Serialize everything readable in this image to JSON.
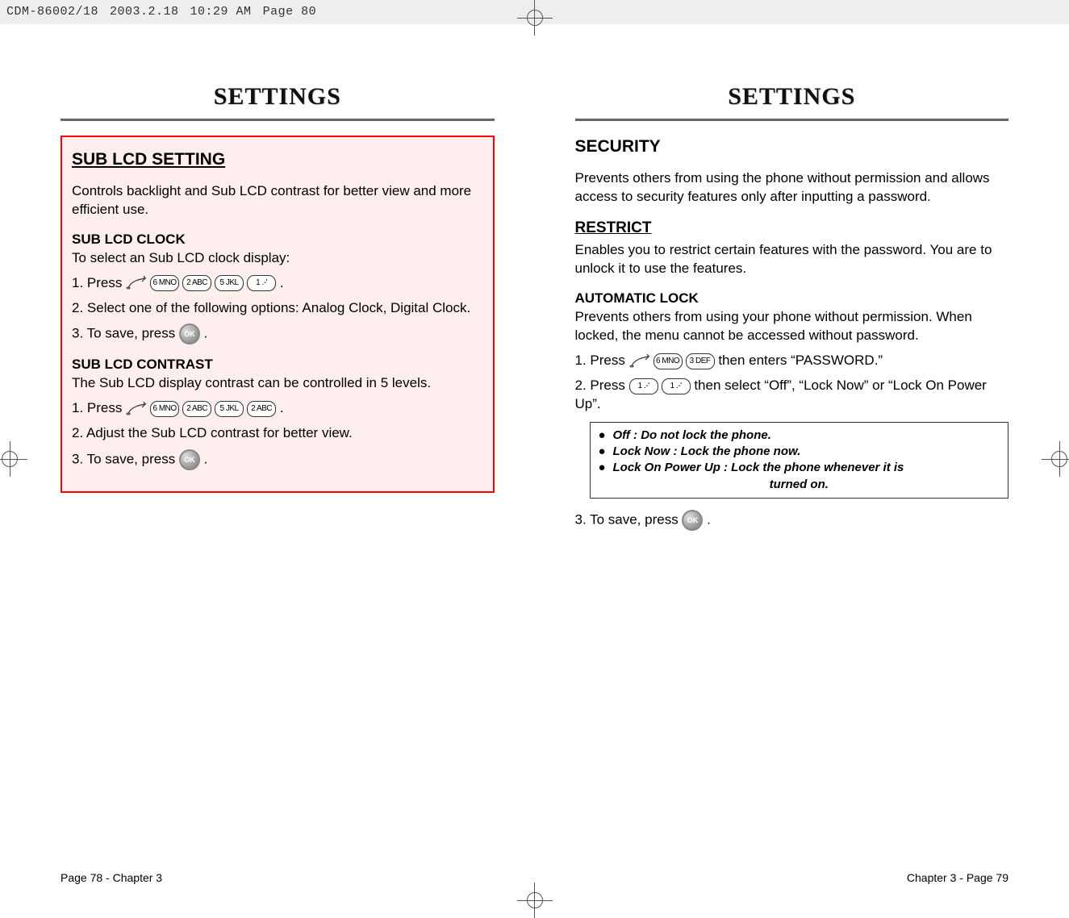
{
  "print_meta": {
    "file": "CDM-86002/18",
    "date": "2003.2.18",
    "time": "10:29 AM",
    "page_label": "Page 80"
  },
  "headings": {
    "settings": "SETTINGS"
  },
  "left": {
    "title": "SUB LCD SETTING",
    "intro": "Controls backlight and Sub LCD contrast for better view and more efficient use.",
    "clock": {
      "heading": "SUB LCD CLOCK",
      "desc": "To select an Sub LCD clock display:",
      "step1_prefix": "1. Press",
      "step1_suffix": ".",
      "key_seq": [
        "6 MNO",
        "2 ABC",
        "5 JKL",
        "1 .-'"
      ],
      "step2": "2. Select one of the following options:  Analog Clock, Digital Clock.",
      "step3_prefix": "3. To save, press",
      "step3_suffix": "."
    },
    "contrast": {
      "heading": "SUB LCD CONTRAST",
      "desc": "The Sub LCD display contrast can be controlled in 5 levels.",
      "step1_prefix": "1. Press",
      "step1_suffix": ".",
      "key_seq": [
        "6 MNO",
        "2 ABC",
        "5 JKL",
        "2 ABC"
      ],
      "step2": "2. Adjust the Sub LCD contrast for better view.",
      "step3_prefix": "3. To save, press",
      "step3_suffix": "."
    },
    "footer": "Page 78 - Chapter 3"
  },
  "right": {
    "title": "SECURITY",
    "intro": "Prevents others from using the phone without permission and allows access to security features only after inputting a password.",
    "restrict": {
      "heading": "RESTRICT",
      "desc": "Enables you to restrict certain features with the password. You are to unlock it to use the features."
    },
    "autolock": {
      "heading": "AUTOMATIC LOCK",
      "desc": "Prevents others from using your phone without permission. When locked, the menu cannot be accessed without password.",
      "step1_prefix": "1. Press",
      "step1_mid": "then enters",
      "step1_password": "“PASSWORD.”",
      "key_seq1": [
        "6 MNO",
        "3 DEF"
      ],
      "step2_prefix": "2. Press",
      "step2_mid": "then select",
      "step2_options": "“Off”, “Lock Now” or “Lock On Power Up”.",
      "key_seq2": [
        "1 .-'",
        "1 .-'"
      ],
      "options": [
        "Off : Do not lock the phone.",
        "Lock Now : Lock the phone now.",
        "Lock On Power Up : Lock the phone whenever it is"
      ],
      "options_cont": "turned on.",
      "step3_prefix": "3. To save, press",
      "step3_suffix": "."
    },
    "footer": "Chapter 3 - Page 79"
  },
  "icons": {
    "ok": "OK"
  }
}
